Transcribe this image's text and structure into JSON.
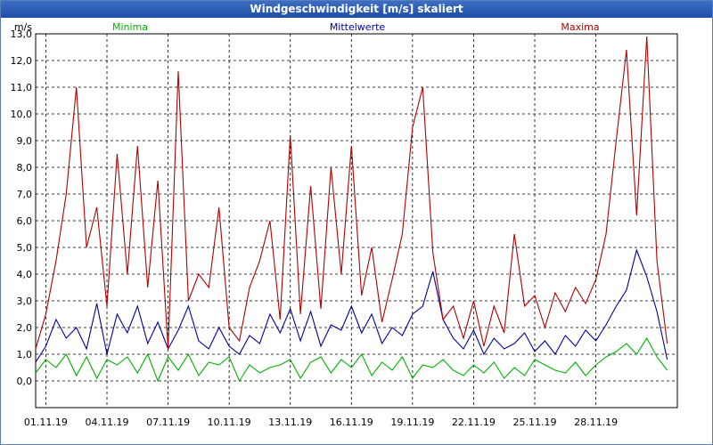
{
  "window": {
    "title": "Windgeschwindigkeit [m/s] skaliert"
  },
  "chart_data": {
    "type": "line",
    "title": "Windgeschwindigkeit [m/s] skaliert",
    "ylabel": "m/s",
    "ylim": [
      -1.0,
      13.0
    ],
    "yticks": [
      "0,0",
      "1,0",
      "2,0",
      "3,0",
      "4,0",
      "5,0",
      "6,0",
      "7,0",
      "8,0",
      "9,0",
      "10,0",
      "11,0",
      "12,0",
      "13,0"
    ],
    "xticks": [
      "01.11.19",
      "04.11.19",
      "07.11.19",
      "10.11.19",
      "13.11.19",
      "16.11.19",
      "19.11.19",
      "22.11.19",
      "25.11.19",
      "28.11.19"
    ],
    "xlim": [
      0,
      31.5
    ],
    "grid": true,
    "legend_placement": "top",
    "series": [
      {
        "name": "Minima",
        "color": "#00b000",
        "x": [
          0,
          0.5,
          1,
          1.5,
          2,
          2.5,
          3,
          3.5,
          4,
          4.5,
          5,
          5.5,
          6,
          6.5,
          7,
          7.5,
          8,
          8.5,
          9,
          9.5,
          10,
          10.5,
          11,
          11.5,
          12,
          12.5,
          13,
          13.5,
          14,
          14.5,
          15,
          15.5,
          16,
          16.5,
          17,
          17.5,
          18,
          18.5,
          19,
          19.5,
          20,
          20.5,
          21,
          21.5,
          22,
          22.5,
          23,
          23.5,
          24,
          24.5,
          25,
          25.5,
          26,
          26.5,
          27,
          27.5,
          28,
          28.5,
          29,
          29.5,
          30,
          30.5,
          31
        ],
        "values": [
          0.3,
          0.8,
          0.5,
          1.0,
          0.2,
          0.9,
          0.1,
          0.8,
          0.6,
          0.9,
          0.3,
          1.0,
          0.0,
          0.9,
          0.4,
          1.0,
          0.2,
          0.7,
          0.6,
          0.9,
          0.0,
          0.6,
          0.3,
          0.5,
          0.6,
          0.8,
          0.1,
          0.7,
          0.9,
          0.3,
          0.8,
          0.5,
          1.0,
          0.2,
          0.7,
          0.4,
          0.9,
          0.1,
          0.6,
          0.5,
          0.8,
          0.4,
          0.2,
          0.6,
          0.3,
          0.7,
          0.1,
          0.5,
          0.2,
          0.8,
          0.6,
          0.4,
          0.3,
          0.7,
          0.2,
          0.6,
          0.9,
          1.1,
          1.4,
          1.0,
          1.6,
          0.9,
          0.4
        ]
      },
      {
        "name": "Mittelwerte",
        "color": "#0000a0",
        "x": [
          0,
          0.5,
          1,
          1.5,
          2,
          2.5,
          3,
          3.5,
          4,
          4.5,
          5,
          5.5,
          6,
          6.5,
          7,
          7.5,
          8,
          8.5,
          9,
          9.5,
          10,
          10.5,
          11,
          11.5,
          12,
          12.5,
          13,
          13.5,
          14,
          14.5,
          15,
          15.5,
          16,
          16.5,
          17,
          17.5,
          18,
          18.5,
          19,
          19.5,
          20,
          20.5,
          21,
          21.5,
          22,
          22.5,
          23,
          23.5,
          24,
          24.5,
          25,
          25.5,
          26,
          26.5,
          27,
          27.5,
          28,
          28.5,
          29,
          29.5,
          30,
          30.5,
          31
        ],
        "values": [
          0.7,
          1.3,
          2.3,
          1.6,
          2.0,
          1.2,
          2.9,
          1.0,
          2.5,
          1.8,
          2.8,
          1.4,
          2.2,
          1.2,
          1.9,
          2.8,
          1.5,
          1.2,
          2.0,
          1.3,
          1.0,
          1.7,
          1.4,
          2.5,
          1.8,
          2.7,
          1.5,
          2.6,
          1.3,
          2.1,
          1.9,
          2.8,
          1.8,
          2.5,
          1.4,
          2.0,
          1.7,
          2.5,
          2.8,
          4.1,
          2.3,
          1.6,
          1.2,
          1.9,
          1.0,
          1.6,
          1.2,
          1.4,
          1.8,
          1.1,
          1.5,
          1.0,
          1.7,
          1.3,
          1.9,
          1.5,
          2.1,
          2.8,
          3.4,
          4.9,
          3.9,
          2.6,
          0.8
        ]
      },
      {
        "name": "Maxima",
        "color": "#b00000",
        "x": [
          0,
          0.5,
          1,
          1.5,
          2,
          2.5,
          3,
          3.5,
          4,
          4.5,
          5,
          5.5,
          6,
          6.5,
          7,
          7.5,
          8,
          8.5,
          9,
          9.5,
          10,
          10.5,
          11,
          11.5,
          12,
          12.5,
          13,
          13.5,
          14,
          14.5,
          15,
          15.5,
          16,
          16.5,
          17,
          17.5,
          18,
          18.5,
          19,
          19.5,
          20,
          20.5,
          21,
          21.5,
          22,
          22.5,
          23,
          23.5,
          24,
          24.5,
          25,
          25.5,
          26,
          26.5,
          27,
          27.5,
          28,
          28.5,
          29,
          29.5,
          30,
          30.5,
          31
        ],
        "values": [
          1.2,
          2.5,
          4.5,
          7.0,
          11.0,
          5.0,
          6.5,
          2.8,
          8.5,
          4.0,
          8.8,
          3.5,
          7.5,
          1.2,
          11.6,
          3.0,
          4.0,
          3.5,
          6.5,
          2.0,
          1.5,
          3.5,
          4.5,
          6.0,
          2.3,
          9.2,
          2.5,
          7.3,
          2.7,
          8.0,
          4.0,
          8.8,
          3.2,
          5.0,
          2.2,
          3.8,
          5.5,
          9.5,
          11.0,
          4.8,
          2.3,
          2.8,
          1.6,
          3.0,
          1.3,
          2.8,
          1.8,
          5.5,
          2.8,
          3.2,
          2.0,
          3.3,
          2.6,
          3.5,
          2.9,
          3.8,
          5.5,
          9.0,
          12.4,
          6.2,
          12.9,
          4.5,
          1.4
        ]
      }
    ]
  }
}
